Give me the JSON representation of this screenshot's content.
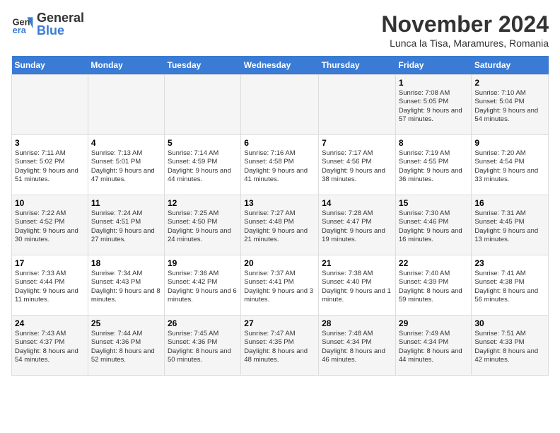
{
  "logo": {
    "line1": "General",
    "line2": "Blue"
  },
  "title": "November 2024",
  "location": "Lunca la Tisa, Maramures, Romania",
  "weekdays": [
    "Sunday",
    "Monday",
    "Tuesday",
    "Wednesday",
    "Thursday",
    "Friday",
    "Saturday"
  ],
  "weeks": [
    [
      {
        "day": "",
        "info": ""
      },
      {
        "day": "",
        "info": ""
      },
      {
        "day": "",
        "info": ""
      },
      {
        "day": "",
        "info": ""
      },
      {
        "day": "",
        "info": ""
      },
      {
        "day": "1",
        "info": "Sunrise: 7:08 AM\nSunset: 5:05 PM\nDaylight: 9 hours and 57 minutes."
      },
      {
        "day": "2",
        "info": "Sunrise: 7:10 AM\nSunset: 5:04 PM\nDaylight: 9 hours and 54 minutes."
      }
    ],
    [
      {
        "day": "3",
        "info": "Sunrise: 7:11 AM\nSunset: 5:02 PM\nDaylight: 9 hours and 51 minutes."
      },
      {
        "day": "4",
        "info": "Sunrise: 7:13 AM\nSunset: 5:01 PM\nDaylight: 9 hours and 47 minutes."
      },
      {
        "day": "5",
        "info": "Sunrise: 7:14 AM\nSunset: 4:59 PM\nDaylight: 9 hours and 44 minutes."
      },
      {
        "day": "6",
        "info": "Sunrise: 7:16 AM\nSunset: 4:58 PM\nDaylight: 9 hours and 41 minutes."
      },
      {
        "day": "7",
        "info": "Sunrise: 7:17 AM\nSunset: 4:56 PM\nDaylight: 9 hours and 38 minutes."
      },
      {
        "day": "8",
        "info": "Sunrise: 7:19 AM\nSunset: 4:55 PM\nDaylight: 9 hours and 36 minutes."
      },
      {
        "day": "9",
        "info": "Sunrise: 7:20 AM\nSunset: 4:54 PM\nDaylight: 9 hours and 33 minutes."
      }
    ],
    [
      {
        "day": "10",
        "info": "Sunrise: 7:22 AM\nSunset: 4:52 PM\nDaylight: 9 hours and 30 minutes."
      },
      {
        "day": "11",
        "info": "Sunrise: 7:24 AM\nSunset: 4:51 PM\nDaylight: 9 hours and 27 minutes."
      },
      {
        "day": "12",
        "info": "Sunrise: 7:25 AM\nSunset: 4:50 PM\nDaylight: 9 hours and 24 minutes."
      },
      {
        "day": "13",
        "info": "Sunrise: 7:27 AM\nSunset: 4:48 PM\nDaylight: 9 hours and 21 minutes."
      },
      {
        "day": "14",
        "info": "Sunrise: 7:28 AM\nSunset: 4:47 PM\nDaylight: 9 hours and 19 minutes."
      },
      {
        "day": "15",
        "info": "Sunrise: 7:30 AM\nSunset: 4:46 PM\nDaylight: 9 hours and 16 minutes."
      },
      {
        "day": "16",
        "info": "Sunrise: 7:31 AM\nSunset: 4:45 PM\nDaylight: 9 hours and 13 minutes."
      }
    ],
    [
      {
        "day": "17",
        "info": "Sunrise: 7:33 AM\nSunset: 4:44 PM\nDaylight: 9 hours and 11 minutes."
      },
      {
        "day": "18",
        "info": "Sunrise: 7:34 AM\nSunset: 4:43 PM\nDaylight: 9 hours and 8 minutes."
      },
      {
        "day": "19",
        "info": "Sunrise: 7:36 AM\nSunset: 4:42 PM\nDaylight: 9 hours and 6 minutes."
      },
      {
        "day": "20",
        "info": "Sunrise: 7:37 AM\nSunset: 4:41 PM\nDaylight: 9 hours and 3 minutes."
      },
      {
        "day": "21",
        "info": "Sunrise: 7:38 AM\nSunset: 4:40 PM\nDaylight: 9 hours and 1 minute."
      },
      {
        "day": "22",
        "info": "Sunrise: 7:40 AM\nSunset: 4:39 PM\nDaylight: 8 hours and 59 minutes."
      },
      {
        "day": "23",
        "info": "Sunrise: 7:41 AM\nSunset: 4:38 PM\nDaylight: 8 hours and 56 minutes."
      }
    ],
    [
      {
        "day": "24",
        "info": "Sunrise: 7:43 AM\nSunset: 4:37 PM\nDaylight: 8 hours and 54 minutes."
      },
      {
        "day": "25",
        "info": "Sunrise: 7:44 AM\nSunset: 4:36 PM\nDaylight: 8 hours and 52 minutes."
      },
      {
        "day": "26",
        "info": "Sunrise: 7:45 AM\nSunset: 4:36 PM\nDaylight: 8 hours and 50 minutes."
      },
      {
        "day": "27",
        "info": "Sunrise: 7:47 AM\nSunset: 4:35 PM\nDaylight: 8 hours and 48 minutes."
      },
      {
        "day": "28",
        "info": "Sunrise: 7:48 AM\nSunset: 4:34 PM\nDaylight: 8 hours and 46 minutes."
      },
      {
        "day": "29",
        "info": "Sunrise: 7:49 AM\nSunset: 4:34 PM\nDaylight: 8 hours and 44 minutes."
      },
      {
        "day": "30",
        "info": "Sunrise: 7:51 AM\nSunset: 4:33 PM\nDaylight: 8 hours and 42 minutes."
      }
    ]
  ]
}
